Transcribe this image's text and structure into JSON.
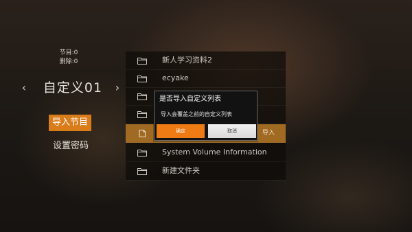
{
  "left_panel": {
    "program_count": "节目:0",
    "deleted_count": "删除:0",
    "list_name": "自定义01",
    "prev_icon": "chevron-left-icon",
    "next_icon": "chevron-right-icon",
    "import_label": "导入节目",
    "password_label": "设置密码"
  },
  "file_list": {
    "items": [
      {
        "name": "新人学习资料2",
        "icon": "folder-icon"
      },
      {
        "name": "ecyake",
        "icon": "folder-icon"
      },
      {
        "name": "",
        "icon": "folder-icon"
      },
      {
        "name": "",
        "icon": "folder-icon"
      },
      {
        "name": "",
        "icon": "file-icon",
        "hint": "导入"
      },
      {
        "name": "System Volume Information",
        "icon": "folder-icon"
      },
      {
        "name": "新建文件夹",
        "icon": "folder-icon"
      }
    ],
    "selected_index": 4
  },
  "dialog": {
    "title": "是否导入自定义列表",
    "message": "导入会覆盖之前的自定义列表",
    "ok_label": "确定",
    "cancel_label": "取消"
  },
  "colors": {
    "accent": "#ee7b13",
    "import_button": "#d97c1a",
    "selected_row": "#a06a22"
  }
}
